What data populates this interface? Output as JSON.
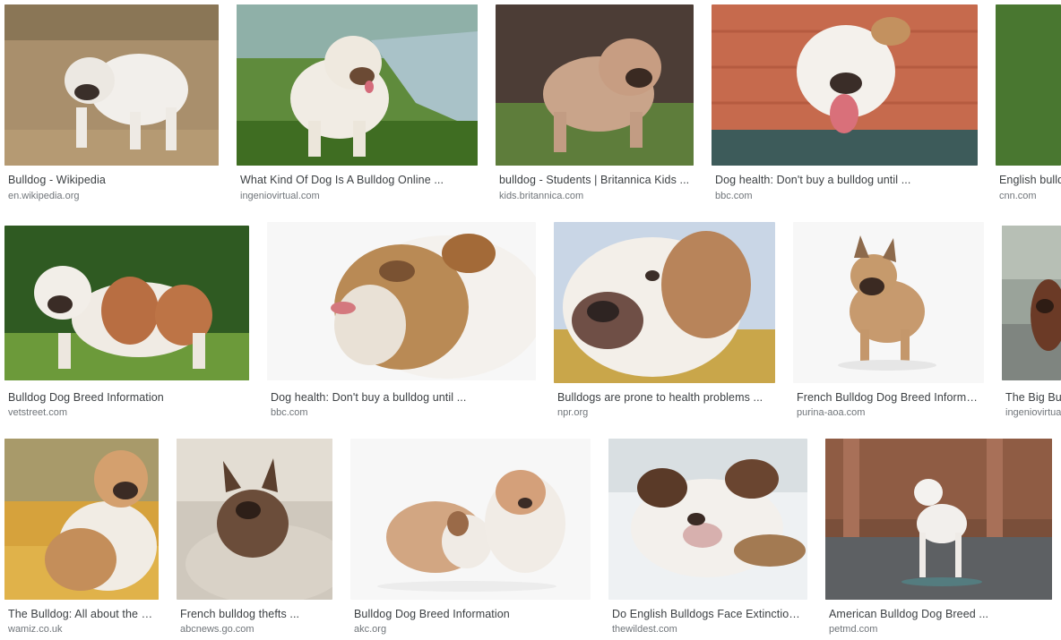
{
  "results": [
    {
      "title": "Bulldog - Wikipedia",
      "source": "en.wikipedia.org",
      "image": "white bulldog standing on dry grass"
    },
    {
      "title": "What Kind Of Dog Is A Bulldog Online ...",
      "source": "ingeniovirtual.com",
      "image": "bulldog with tongue out by a lake"
    },
    {
      "title": "bulldog - Students | Britannica Kids ...",
      "source": "kids.britannica.com",
      "image": "fawn bulldog standing on grass"
    },
    {
      "title": "Dog health: Don't buy a bulldog until ...",
      "source": "bbc.com",
      "image": "bulldog with tongue out in front of a red brick wall"
    },
    {
      "title": "English bulld",
      "source": "cnn.com",
      "image": "bulldog on green background"
    },
    {
      "title": "Bulldog Dog Breed Information",
      "source": "vetstreet.com",
      "image": "white and red bulldog on grass"
    },
    {
      "title": "Dog health: Don't buy a bulldog until ...",
      "source": "bbc.com",
      "image": "bulldog head in profile"
    },
    {
      "title": "Bulldogs are prone to health problems ...",
      "source": "npr.org",
      "image": "close-up of a bulldog face"
    },
    {
      "title": "French Bulldog Dog Breed Informati...",
      "source": "purina-aoa.com",
      "image": "fawn french bulldog standing"
    },
    {
      "title": "The Big Bul",
      "source": "ingeniovirtual",
      "image": "brown american bully on a road"
    },
    {
      "title": "The Bulldog: All about the br...",
      "source": "wamiz.co.uk",
      "image": "bulldog sitting in autumn leaves"
    },
    {
      "title": "French bulldog thefts ...",
      "source": "abcnews.go.com",
      "image": "brown french bulldog on a blanket"
    },
    {
      "title": "Bulldog Dog Breed Information",
      "source": "akc.org",
      "image": "two bulldog puppies"
    },
    {
      "title": "Do English Bulldogs Face Extinction ...",
      "source": "thewildest.com",
      "image": "bulldog lying down"
    },
    {
      "title": "American Bulldog Dog Breed ...",
      "source": "petmd.com",
      "image": "white american bulldog standing on pavement"
    }
  ]
}
